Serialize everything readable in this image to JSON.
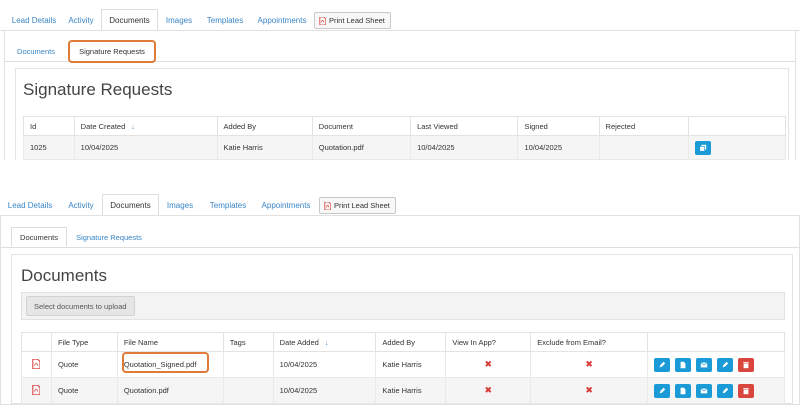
{
  "top": {
    "tabs": [
      "Lead Details",
      "Activity",
      "Documents",
      "Images",
      "Templates",
      "Appointments"
    ],
    "active_tab": "Documents",
    "print_label": "Print Lead Sheet",
    "subtabs": [
      "Documents",
      "Signature Requests"
    ],
    "active_subtab": "Signature Requests",
    "heading": "Signature Requests",
    "table": {
      "headers": [
        "Id",
        "Date Created",
        "Added By",
        "Document",
        "Last Viewed",
        "Signed",
        "Rejected",
        ""
      ],
      "sort_arrow": "↓",
      "rows": [
        [
          "1025",
          "10/04/2025",
          "Katie Harris",
          "Quotation.pdf",
          "10/04/2025",
          "10/04/2025",
          ""
        ]
      ]
    }
  },
  "bottom": {
    "tabs": [
      "Lead Details",
      "Activity",
      "Documents",
      "Images",
      "Templates",
      "Appointments"
    ],
    "active_tab": "Documents",
    "print_label": "Print Lead Sheet",
    "subtabs": [
      "Documents",
      "Signature Requests"
    ],
    "active_subtab": "Documents",
    "heading": "Documents",
    "upload_label": "Select documents to upload",
    "table": {
      "headers": [
        "",
        "File Type",
        "File Name",
        "Tags",
        "Date Added",
        "Added By",
        "View In App?",
        "Exclude from Email?",
        ""
      ],
      "sort_arrow": "↓",
      "rows": [
        {
          "type": "Quote",
          "name": "Quotation_Signed.pdf",
          "tags": "",
          "date": "10/04/2025",
          "by": "Katie Harris",
          "view": "✖",
          "exclude": "✖"
        },
        {
          "type": "Quote",
          "name": "Quotation.pdf",
          "tags": "",
          "date": "10/04/2025",
          "by": "Katie Harris",
          "view": "✖",
          "exclude": "✖"
        }
      ]
    }
  },
  "colors": {
    "link": "#3a86c6",
    "action_blue": "#1a9ad6",
    "action_red": "#d9463d",
    "callout": "#e07b39",
    "pdf_red": "#d9322f"
  },
  "icons": {
    "copy": "copy-icon",
    "edit": "pencil-icon",
    "file": "file-icon",
    "email": "envelope-icon",
    "delete": "trash-icon",
    "pdf": "pdf-icon",
    "x": "cross-icon"
  }
}
